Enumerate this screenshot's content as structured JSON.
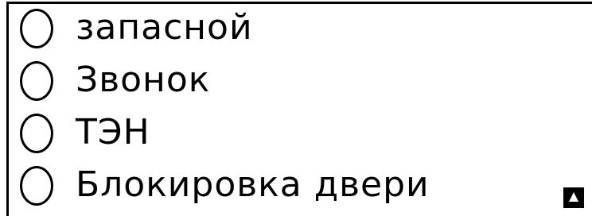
{
  "outputs": [
    {
      "label": "запасной",
      "state": "off"
    },
    {
      "label": "Звонок",
      "state": "off"
    },
    {
      "label": "ТЭН",
      "state": "off"
    },
    {
      "label": "Блокировка двери",
      "state": "off"
    }
  ],
  "indicator": {
    "icon": "lock-icon"
  },
  "colors": {
    "foreground": "#000000",
    "background": "#ffffff"
  }
}
